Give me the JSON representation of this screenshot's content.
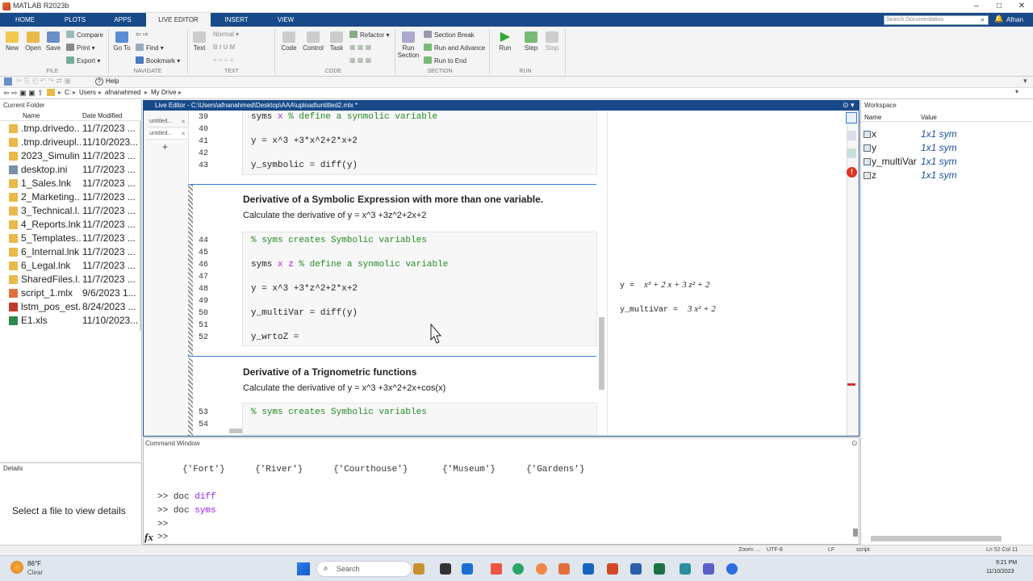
{
  "title": "MATLAB R2023b",
  "ribbon_tabs": [
    "HOME",
    "PLOTS",
    "APPS",
    "LIVE EDITOR",
    "INSERT",
    "VIEW"
  ],
  "search_placeholder": "Search Documentation",
  "user": "Afnan",
  "ribbon": {
    "file": {
      "new": "New",
      "open": "Open",
      "save": "Save",
      "compare": "Compare",
      "print": "Print",
      "export": "Export",
      "group": "FILE"
    },
    "navigate": {
      "goto": "Go To",
      "find": "Find",
      "bookmark": "Bookmark",
      "group": "NAVIGATE"
    },
    "text": {
      "text": "Text",
      "style": "Normal",
      "group": "TEXT"
    },
    "code": {
      "code": "Code",
      "control": "Control",
      "task": "Task",
      "refactor": "Refactor",
      "group": "CODE"
    },
    "section": {
      "run_section": "Run Section",
      "section_break": "Section Break",
      "run_advance": "Run and Advance",
      "run_end": "Run to End",
      "group": "SECTION"
    },
    "run": {
      "run": "Run",
      "step": "Step",
      "stop": "Stop",
      "group": "RUN"
    }
  },
  "qat_help": "Help",
  "address": [
    "C:",
    "Users",
    "afnanahmed",
    "My Drive"
  ],
  "current_folder": {
    "title": "Current Folder",
    "col_name": "Name",
    "col_date": "Date Modified",
    "files": [
      {
        "name": ".tmp.drivedo...",
        "date": "11/7/2023 ...",
        "kind": "folder"
      },
      {
        "name": ".tmp.driveupl...",
        "date": "11/10/2023...",
        "kind": "folder"
      },
      {
        "name": "2023_Simulin...",
        "date": "11/7/2023 ...",
        "kind": "folder"
      },
      {
        "name": "desktop.ini",
        "date": "11/7/2023 ...",
        "kind": "ini"
      },
      {
        "name": "1_Sales.lnk",
        "date": "11/7/2023 ...",
        "kind": "folder"
      },
      {
        "name": "2_Marketing...",
        "date": "11/7/2023 ...",
        "kind": "folder"
      },
      {
        "name": "3_Technical.l...",
        "date": "11/7/2023 ...",
        "kind": "folder"
      },
      {
        "name": "4_Reports.lnk",
        "date": "11/7/2023 ...",
        "kind": "folder"
      },
      {
        "name": "5_Templates....",
        "date": "11/7/2023 ...",
        "kind": "folder"
      },
      {
        "name": "6_Internal.lnk",
        "date": "11/7/2023 ...",
        "kind": "folder"
      },
      {
        "name": "6_Legal.lnk",
        "date": "11/7/2023 ...",
        "kind": "folder"
      },
      {
        "name": "SharedFiles.l...",
        "date": "11/7/2023 ...",
        "kind": "folder"
      },
      {
        "name": "script_1.mlx",
        "date": "9/6/2023 1...",
        "kind": "mlx"
      },
      {
        "name": "lstm_pos_est...",
        "date": "8/24/2023 ...",
        "kind": "mat"
      },
      {
        "name": "E1.xls",
        "date": "11/10/2023...",
        "kind": "xls"
      }
    ]
  },
  "details": {
    "title": "Details",
    "message": "Select a file to view details"
  },
  "editor": {
    "header": "Live Editor - C:\\Users\\afnanahmed\\Desktop\\AAA\\upload\\untitled2.mlx *",
    "file_tabs": [
      "untitled...",
      "untitled..."
    ],
    "add_tab": "+",
    "lines_top": [
      {
        "n": "39",
        "code": "syms ",
        "var": "x",
        "comment": " % define a synmolic variable"
      },
      {
        "n": "40",
        "code": ""
      },
      {
        "n": "41",
        "code": "y = x^3 +3*x^2+2*x+2"
      },
      {
        "n": "42",
        "code": ""
      },
      {
        "n": "43",
        "code": "y_symbolic = diff(y)"
      }
    ],
    "section2_title": "Derivative of a Symbolic Expression with more than one variable.",
    "section2_text": "Calculate the derivative of y = x^3 +3z^2+2x+2",
    "lines_mid": [
      {
        "n": "44",
        "comment": "% syms creates Symbolic variables"
      },
      {
        "n": "45",
        "code": ""
      },
      {
        "n": "46",
        "code": "syms ",
        "var": "x z",
        "comment": " % define a synmolic variable"
      },
      {
        "n": "47",
        "code": ""
      },
      {
        "n": "48",
        "code": "y = x^3 +3*z^2+2*x+2"
      },
      {
        "n": "49",
        "code": ""
      },
      {
        "n": "50",
        "code": "y_multiVar = diff(y)"
      },
      {
        "n": "51",
        "code": ""
      },
      {
        "n": "52",
        "code": "y_wrtoZ ="
      }
    ],
    "section3_title": "Derivative of a Trignometric functions",
    "section3_text": "Calculate the derivative of y = x^3 +3x^2+2x+cos(x)",
    "lines_bot": [
      {
        "n": "53",
        "comment": "% syms creates Symbolic variables"
      },
      {
        "n": "54",
        "code": ""
      }
    ],
    "output1_label": "y =",
    "output1_math": "x³ + 2 x + 3 z² + 2",
    "output2_label": "y_multiVar =",
    "output2_math": "3 x² + 2"
  },
  "workspace": {
    "title": "Workspace",
    "col_name": "Name",
    "col_value": "Value",
    "vars": [
      {
        "name": "x",
        "value": "1x1 sym"
      },
      {
        "name": "y",
        "value": "1x1 sym"
      },
      {
        "name": "y_multiVar",
        "value": "1x1 sym"
      },
      {
        "name": "z",
        "value": "1x1 sym"
      }
    ]
  },
  "command_window": {
    "title": "Command Window",
    "cells": [
      "{'Fort'}",
      "{'River'}",
      "{'Courthouse'}",
      "{'Museum'}",
      "{'Gardens'}"
    ],
    "history": [
      {
        "prompt": ">>",
        "cmd": "doc ",
        "arg": "diff"
      },
      {
        "prompt": ">>",
        "cmd": "doc ",
        "arg": "syms"
      },
      {
        "prompt": ">>",
        "cmd": "",
        "arg": ""
      }
    ],
    "fx": "fx",
    "active_prompt": ">>"
  },
  "status": {
    "zoom": "Zoom: ...",
    "encoding": "UTF-8",
    "eol": "LF",
    "type": "script",
    "pos": "Ln 52  Col 11"
  },
  "taskbar": {
    "weather_temp": "86°F",
    "weather_desc": "Clear",
    "search": "Search",
    "time": "9:21 PM",
    "date": "11/10/2023"
  },
  "colors": {
    "accent": "#184a8a",
    "string": "#a020f0",
    "comment": "#228b22",
    "ws_value": "#1a4fa0"
  }
}
